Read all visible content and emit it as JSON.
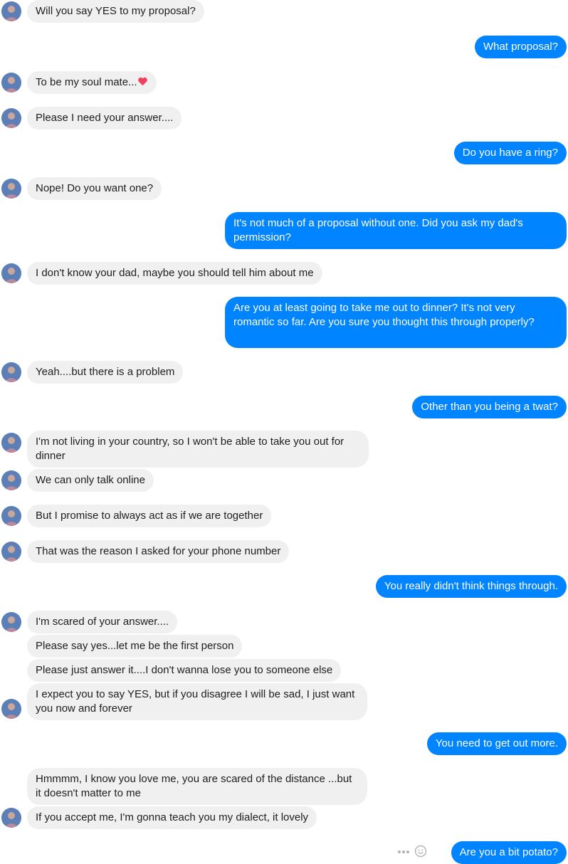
{
  "messages": [
    {
      "from": "them",
      "text": "Will you say YES to my proposal?",
      "avatar": true
    },
    {
      "from": "me",
      "text": "What proposal?"
    },
    {
      "from": "them",
      "text": "To be my soul mate...",
      "avatar": true,
      "emoji": "heart-icon"
    },
    {
      "from": "them",
      "text": "Please I need your answer....",
      "avatar": true
    },
    {
      "from": "me",
      "text": "Do you have a ring?"
    },
    {
      "from": "them",
      "text": "Nope! Do you want one?",
      "avatar": true
    },
    {
      "from": "me",
      "text": "It's not much of a proposal without one. Did you ask my dad's permission?"
    },
    {
      "from": "them",
      "text": "I don't know your dad, maybe you should tell him about me",
      "avatar": true
    },
    {
      "from": "me",
      "text": "Are you at least going to take me out to dinner? It's not very romantic so far. Are you sure you thought this through properly?"
    },
    {
      "from": "them",
      "text": "Yeah....but there is a problem",
      "avatar": true
    },
    {
      "from": "me",
      "text": "Other than you being a twat?"
    },
    {
      "from": "them",
      "text": "I'm not living in your country, so I won't be able to take you out for dinner",
      "avatar": true
    },
    {
      "from": "them",
      "text": "We can only talk online",
      "avatar": true
    },
    {
      "from": "them",
      "text": "But I promise to always act as if we are together",
      "avatar": true
    },
    {
      "from": "them",
      "text": "That was the reason I asked for your phone number",
      "avatar": true
    },
    {
      "from": "me",
      "text": "You really didn't think things through."
    },
    {
      "from": "them",
      "text": "I'm scared of your answer....",
      "avatar": true
    },
    {
      "from": "them",
      "text": "Please say yes...let me be the first person",
      "avatar": false
    },
    {
      "from": "them",
      "text": "Please just answer it....I don't wanna lose you to someone else",
      "avatar": false
    },
    {
      "from": "them",
      "text": "I expect you to say YES, but if  you disagree I will be sad, I just want you now and forever",
      "avatar": true
    },
    {
      "from": "me",
      "text": "You need to get out more."
    },
    {
      "from": "them",
      "text": "Hmmmm, I know you love me, you are scared of the distance ...but it doesn't matter to me",
      "avatar": false
    },
    {
      "from": "them",
      "text": "If you accept me, I'm gonna teach you my dialect, it lovely",
      "avatar": true
    },
    {
      "from": "me",
      "text": "Are you a bit potato?"
    }
  ],
  "colors": {
    "outgoing": "#0084ff",
    "incoming": "#f1f0f0"
  }
}
